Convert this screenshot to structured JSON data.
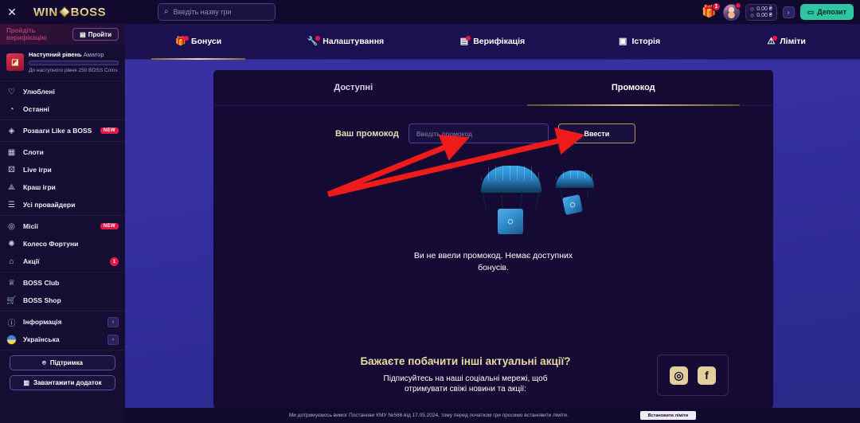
{
  "header": {
    "close_icon": "close-icon",
    "logo_part1": "WIN",
    "logo_part2": "BOSS",
    "search": {
      "placeholder": "Введіть назву гри",
      "value": "",
      "icon": "search-icon"
    },
    "gift_icon": "gift-icon",
    "gift_badge": "1",
    "avatar": "user-avatar",
    "balance": [
      {
        "icon": "coin-icon",
        "amount": "0.00 ₴"
      },
      {
        "icon": "coin-icon",
        "amount": "0.00 ₴"
      }
    ],
    "balance_chevron": "›",
    "deposit_label": "Депозит",
    "deposit_icon": "wallet-icon"
  },
  "sidebar": {
    "verification": {
      "text": "Пройдіть верифікацію",
      "button_label": "Пройти",
      "button_icon": "id-card-icon"
    },
    "level": {
      "title": "Наступний рівень",
      "name": "Аматор",
      "progress_text": "До наступного рівня 250 BOSS Coins",
      "badge_icon": "level-badge-icon",
      "progress_percent": 0
    },
    "groups": [
      {
        "items": [
          {
            "label": "Улюблені",
            "icon": "heart-icon"
          },
          {
            "label": "Останні",
            "icon": "clock-icon"
          }
        ]
      },
      {
        "items": [
          {
            "label": "Розваги Like a BOSS",
            "icon": "diamond-icon",
            "tag": "NEW"
          }
        ]
      },
      {
        "items": [
          {
            "label": "Слоти",
            "icon": "slots-icon"
          },
          {
            "label": "Live ігри",
            "icon": "dice-icon"
          },
          {
            "label": "Краш ігри",
            "icon": "rocket-icon"
          },
          {
            "label": "Усі провайдери",
            "icon": "list-icon"
          }
        ]
      },
      {
        "items": [
          {
            "label": "Місії",
            "icon": "target-icon",
            "tag": "NEW"
          },
          {
            "label": "Колесо Фортуни",
            "icon": "wheel-icon"
          },
          {
            "label": "Акції",
            "icon": "gift-box-icon",
            "count": "1"
          }
        ]
      },
      {
        "items": [
          {
            "label": "BOSS Club",
            "icon": "crown-icon"
          },
          {
            "label": "BOSS Shop",
            "icon": "cart-icon"
          }
        ]
      },
      {
        "items": [
          {
            "label": "Інформація",
            "icon": "info-icon",
            "chevron": "›"
          },
          {
            "label": "Українська",
            "icon": "flag-ua-icon",
            "chevron": "›"
          }
        ]
      }
    ],
    "buttons": [
      {
        "label": "Підтримка",
        "icon": "headset-icon"
      },
      {
        "label": "Завантажити додаток",
        "icon": "app-window-icon"
      }
    ]
  },
  "top_tabs": [
    {
      "label": "Бонуси",
      "icon": "gift-icon",
      "dot": true,
      "active": true
    },
    {
      "label": "Налаштування",
      "icon": "wrench-icon",
      "dot": true,
      "active": false
    },
    {
      "label": "Верифікація",
      "icon": "id-card-icon",
      "dot": true,
      "active": false
    },
    {
      "label": "Історія",
      "icon": "document-icon",
      "dot": false,
      "active": false
    },
    {
      "label": "Ліміти",
      "icon": "warning-triangle-icon",
      "dot": true,
      "active": false
    }
  ],
  "panel": {
    "tabs": [
      {
        "label": "Доступні",
        "active": false
      },
      {
        "label": "Промокод",
        "active": true
      }
    ],
    "promo": {
      "label": "Ваш промокод",
      "input_placeholder": "Введіть промокод",
      "input_value": "",
      "submit_label": "Ввести"
    },
    "empty_message": "Ви не ввели промокод. Немає доступних бонусів.",
    "bottom": {
      "heading": "Бажаєте побачити інші актуальні акції?",
      "subtext": "Підписуйтесь на наші соціальні мережі, щоб отримувати свіжі новини та акції:",
      "socials": [
        {
          "name": "instagram-icon",
          "glyph": "◎"
        },
        {
          "name": "facebook-icon",
          "glyph": "f"
        }
      ]
    }
  },
  "footer": {
    "text": "Ми дотримуємось вимог Постанови КМУ №566 від 17.05.2024, тому перед початком гри просимо встановити ліміти.",
    "button_label": "Встановити ліміти"
  },
  "colors": {
    "accent_gold": "#e2cf9b",
    "brand_green": "#2ec5a0",
    "badge_red": "#e8174a",
    "panel_bg": "#140a33",
    "page_bg": "#3730a3",
    "annotation_red": "#ee1b1b"
  }
}
